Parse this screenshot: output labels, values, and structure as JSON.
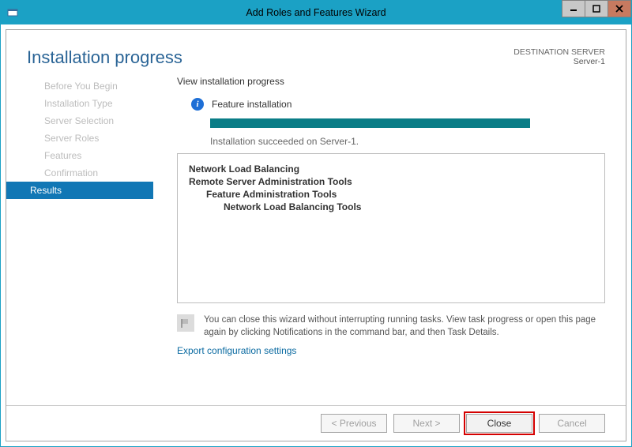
{
  "window": {
    "title": "Add Roles and Features Wizard"
  },
  "header": {
    "title": "Installation progress",
    "dest_label": "DESTINATION SERVER",
    "dest_server": "Server-1"
  },
  "nav": {
    "items": [
      {
        "label": "Before You Begin"
      },
      {
        "label": "Installation Type"
      },
      {
        "label": "Server Selection"
      },
      {
        "label": "Server Roles"
      },
      {
        "label": "Features"
      },
      {
        "label": "Confirmation"
      },
      {
        "label": "Results",
        "selected": true
      }
    ]
  },
  "main": {
    "subhead": "View installation progress",
    "status": "Feature installation",
    "succeeded": "Installation succeeded on Server-1.",
    "results": [
      {
        "text": "Network Load Balancing",
        "level": 0,
        "bold": true
      },
      {
        "text": "Remote Server Administration Tools",
        "level": 0,
        "bold": true
      },
      {
        "text": "Feature Administration Tools",
        "level": 1,
        "bold": true
      },
      {
        "text": "Network Load Balancing Tools",
        "level": 2,
        "bold": true
      }
    ],
    "hint": "You can close this wizard without interrupting running tasks. View task progress or open this page again by clicking Notifications in the command bar, and then Task Details.",
    "export_link": "Export configuration settings"
  },
  "footer": {
    "previous": "<  Previous",
    "next": "Next  >",
    "close": "Close",
    "cancel": "Cancel"
  }
}
